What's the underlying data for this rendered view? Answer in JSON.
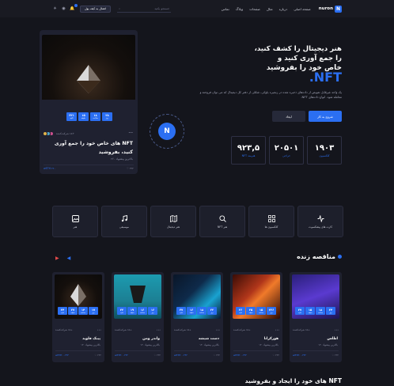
{
  "header": {
    "logo_letter": "N",
    "logo_text": "nuron",
    "nav": [
      "صفحه اصلی",
      "درباره",
      "مثال",
      "صفحات",
      "وبلاگ",
      "تماس"
    ],
    "search_placeholder": "جستجو بکنید",
    "wallet": "اتصال به کیف پول",
    "notif_count": "6"
  },
  "hero": {
    "line1": "هنر دیجیتال را کشف کنید،",
    "line2": "را جمع آوری کنید و",
    "line3": "خاص خود را بفروشید",
    "nft": "NFT.",
    "desc": "یک واحد غیرقابل تعویض از داده‌های ذخیره شده در زنجیره بلوکی، شکلی از دفتر کل دیجیتال که می توان فروخته و معامله شود. انواع داده‌های NFT.",
    "btn_primary": "شروع به کار",
    "btn_secondary": "ایجاد",
    "stats": [
      {
        "value": "۱۹۰۳",
        "label": "کلکسیون"
      },
      {
        "value": "۲۰۵۰۱",
        "label": "حراجی"
      },
      {
        "value": "۹۲۳,۵",
        "label": "هنرمند NFT"
      }
    ]
  },
  "hero_card": {
    "countdown": [
      {
        "n": "۲۸",
        "u": "روز"
      },
      {
        "n": "۱۸",
        "u": "ساعت"
      },
      {
        "n": "۱۵",
        "u": "دقیقه"
      },
      {
        "n": "۳۲۱",
        "u": "ثانیه"
      }
    ],
    "owners_text": "+۱۵ شرکت‌کننده",
    "owners_icon": "dots",
    "title": "NFT های خاص خود را جمع آوری کنید، بفروشید",
    "price": "بالاترین پیشنهاد ۲۶۰",
    "price_value": "۲۶۰ wETH",
    "likes": "۳۲۲"
  },
  "badge": {
    "letter": "N"
  },
  "categories": [
    {
      "label": "هنر",
      "icon": "image-icon"
    },
    {
      "label": "موسیقی",
      "icon": "music-icon"
    },
    {
      "label": "هنر دیجیتال",
      "icon": "map-icon"
    },
    {
      "label": "هنر NFT",
      "icon": "search-icon"
    },
    {
      "label": "کلکسیون ها",
      "icon": "grid-icon"
    },
    {
      "label": "کارت های پیشکسوت",
      "icon": "activity-icon"
    }
  ],
  "live": {
    "title": "مناقصه زنده",
    "cards": [
      {
        "name": "پینک فلوید",
        "price": "بالاترین پیشنهاد ۱۳۰",
        "value": "۰.۲۴۴ wETH",
        "likes": "۲۲۲",
        "owners": "+۱۵ شرکت‌کننده",
        "cd": [
          "۱۷",
          "۱۴",
          "۲۷",
          "۲۴"
        ]
      },
      {
        "name": "واندر ومن",
        "price": "بالاترین پیشنهاد ۱۳۰",
        "value": "۰.۲۴۴ wETH",
        "likes": "۲۲۲",
        "owners": "+۱۵ شرکت‌کننده",
        "cd": [
          "۱۶",
          "۱۶",
          "۱۹",
          "۲۲"
        ]
      },
      {
        "name": "دست شیشه",
        "price": "بالاترین پیشنهاد ۱۳۰",
        "value": "۰.۲۴۴ wETH",
        "likes": "۲۲۲",
        "owners": "+۱۵ شرکت‌کننده",
        "cd": [
          "۲۲",
          "۱۸",
          "۱۶",
          "۳۷"
        ]
      },
      {
        "name": "هورکراتا",
        "price": "بالاترین پیشنهاد ۱۳۰",
        "value": "۰.۲۴۴ wETH",
        "likes": "۲۲۲",
        "owners": "+۱۵ شرکت‌کننده",
        "cd": [
          "۲۲۶",
          "۱۵",
          "۲۵",
          "۲۶"
        ]
      },
      {
        "name": "اطلس",
        "price": "بالاترین پیشنهاد ۱۳۰",
        "value": "۰.۲۴۴ wETH",
        "likes": "۲۲۲",
        "owners": "+۱۵ شرکت‌کننده",
        "cd": [
          "۲۴",
          "۱۸",
          "۱۵",
          "۲۷"
        ]
      }
    ]
  },
  "bottom_title": "NFT های خود را ایجاد و بفروشید",
  "colors": {
    "accent": "#2b6ff2",
    "bg": "#14151c",
    "card": "#1f2130"
  }
}
